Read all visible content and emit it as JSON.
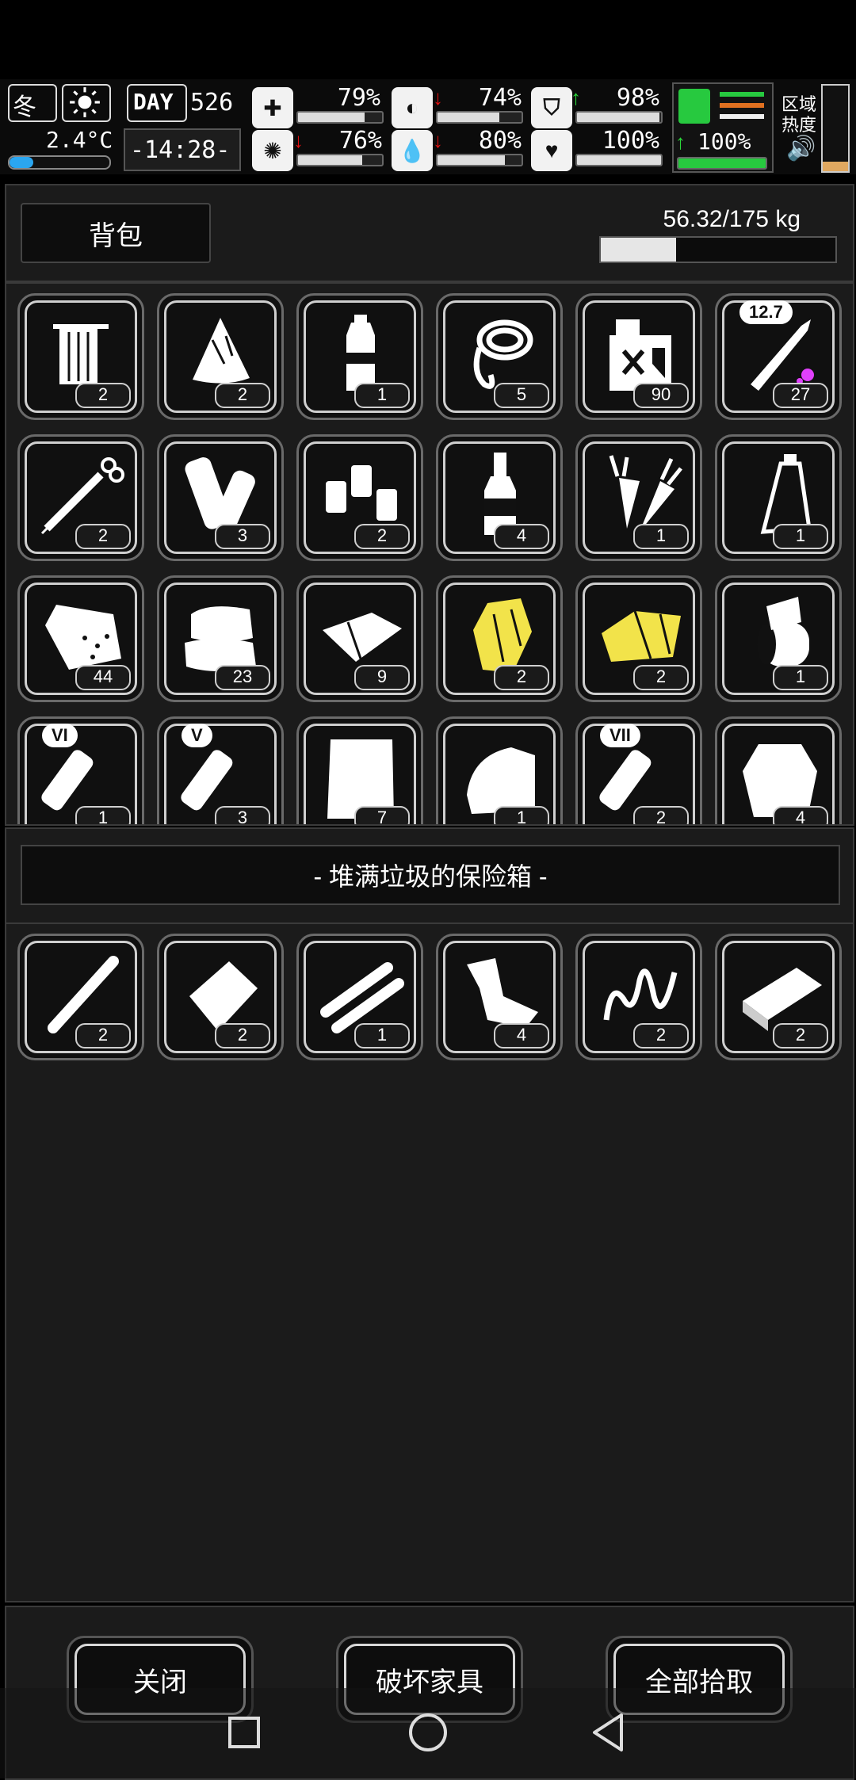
{
  "hud": {
    "season": "冬",
    "temperature": "2.4°C",
    "day_label": "DAY",
    "day_value": "526",
    "time": "-14:28-",
    "stats": [
      {
        "name": "health",
        "value": "79%",
        "fill": 0.79,
        "arrow": ""
      },
      {
        "name": "stomach",
        "value": "74%",
        "fill": 0.74,
        "arrow": "down"
      },
      {
        "name": "armor",
        "value": "98%",
        "fill": 0.98,
        "arrow": "up"
      },
      {
        "name": "mind",
        "value": "76%",
        "fill": 0.76,
        "arrow": "down"
      },
      {
        "name": "water",
        "value": "80%",
        "fill": 0.8,
        "arrow": "down"
      },
      {
        "name": "heart",
        "value": "100%",
        "fill": 1.0,
        "arrow": ""
      },
      {
        "name": "stamina",
        "value": "100%",
        "fill": 1.0,
        "arrow": "up"
      }
    ],
    "zone_label_1": "区域",
    "zone_label_2": "热度"
  },
  "backpack": {
    "title": "背包",
    "weight": "56.32/175 kg",
    "weight_fill": 0.32,
    "items": [
      {
        "icon": "towel-icon",
        "count": "2"
      },
      {
        "icon": "cloth-rag-icon",
        "count": "2"
      },
      {
        "icon": "water-bottle-icon",
        "count": "1"
      },
      {
        "icon": "rope-icon",
        "count": "5"
      },
      {
        "icon": "fuel-canister-icon",
        "count": "90"
      },
      {
        "icon": "rifle-bullet-icon",
        "count": "27",
        "tag": "12.7"
      },
      {
        "icon": "syringe-icon",
        "count": "2"
      },
      {
        "icon": "bandage-roll-icon",
        "count": "3"
      },
      {
        "icon": "small-bottles-icon",
        "count": "2"
      },
      {
        "icon": "liquor-bottle-icon",
        "count": "4"
      },
      {
        "icon": "carrot-icon",
        "count": "1"
      },
      {
        "icon": "glass-bottle-icon",
        "count": "1"
      },
      {
        "icon": "sack-icon",
        "count": "44"
      },
      {
        "icon": "folded-cloth-icon",
        "count": "23"
      },
      {
        "icon": "fabric-sheet-icon",
        "count": "9"
      },
      {
        "icon": "gold-ore-icon",
        "count": "2"
      },
      {
        "icon": "gold-foil-icon",
        "count": "2"
      },
      {
        "icon": "paper-roll-icon",
        "count": "1"
      },
      {
        "icon": "test-tube-vi-icon",
        "count": "1",
        "tag": "VI"
      },
      {
        "icon": "test-tube-v-icon",
        "count": "3",
        "tag": "V"
      },
      {
        "icon": "white-cloth-icon",
        "count": "7"
      },
      {
        "icon": "towel-fold-icon",
        "count": "1"
      },
      {
        "icon": "test-tube-vii-icon",
        "count": "2",
        "tag": "VII"
      },
      {
        "icon": "ragged-coat-icon",
        "count": "4"
      }
    ]
  },
  "container": {
    "title": "- 堆满垃圾的保险箱 -",
    "items": [
      {
        "icon": "pipe-icon",
        "count": "2"
      },
      {
        "icon": "sheet-metal-icon",
        "count": "2"
      },
      {
        "icon": "pipes-pair-icon",
        "count": "1"
      },
      {
        "icon": "scrap-metal-icon",
        "count": "4"
      },
      {
        "icon": "spring-icon",
        "count": "2"
      },
      {
        "icon": "metal-bar-icon",
        "count": "2"
      }
    ]
  },
  "buttons": {
    "close": "关闭",
    "destroy": "破坏家具",
    "take_all": "全部拾取"
  }
}
